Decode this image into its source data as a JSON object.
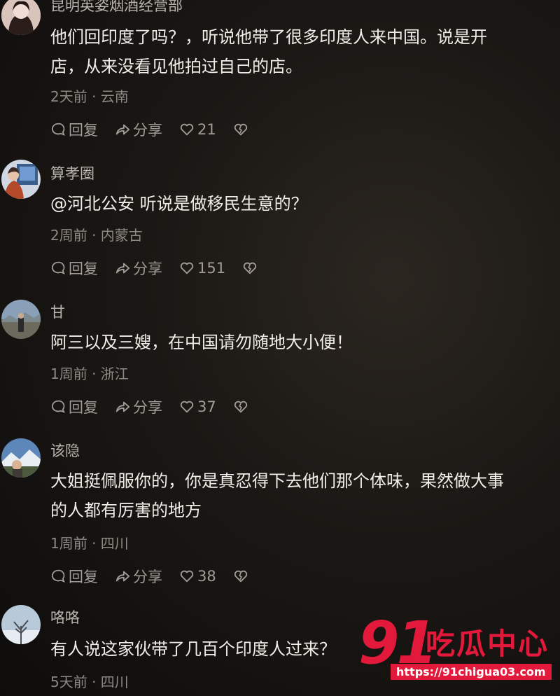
{
  "comments": [
    {
      "username": "昆明英姿烟酒经营部",
      "text_lines": [
        "他们回印度了吗？，听说他带了很多印度人来中国。说是开",
        "店，从来没看见他拍过自己的店。"
      ],
      "meta": "2天前 · 云南",
      "reply": "回复",
      "share": "分享",
      "likes": "21"
    },
    {
      "username": "算孝圈",
      "text_lines": [
        "@河北公安  听说是做移民生意的？"
      ],
      "meta": "2周前 · 内蒙古",
      "reply": "回复",
      "share": "分享",
      "likes": "151"
    },
    {
      "username": "甘",
      "text_lines": [
        "阿三以及三嫂，在中国请勿随地大小便！"
      ],
      "meta": "1周前 · 浙江",
      "reply": "回复",
      "share": "分享",
      "likes": "37"
    },
    {
      "username": "该隐",
      "text_lines": [
        "大姐挺佩服你的，你是真忍得下去他们那个体味，果然做大事",
        "的人都有厉害的地方"
      ],
      "meta": "1周前 · 四川",
      "reply": "回复",
      "share": "分享",
      "likes": "38"
    },
    {
      "username": "咯咯",
      "text_lines": [
        "有人说这家伙带了几百个印度人过来？"
      ],
      "meta": "5天前 · 四川"
    }
  ],
  "watermark": {
    "number": "91",
    "brand": "吃瓜中心",
    "url": "https://91chigua03.com"
  },
  "colors": {
    "watermark_red": "#e3193b",
    "background": "#1a1714"
  }
}
